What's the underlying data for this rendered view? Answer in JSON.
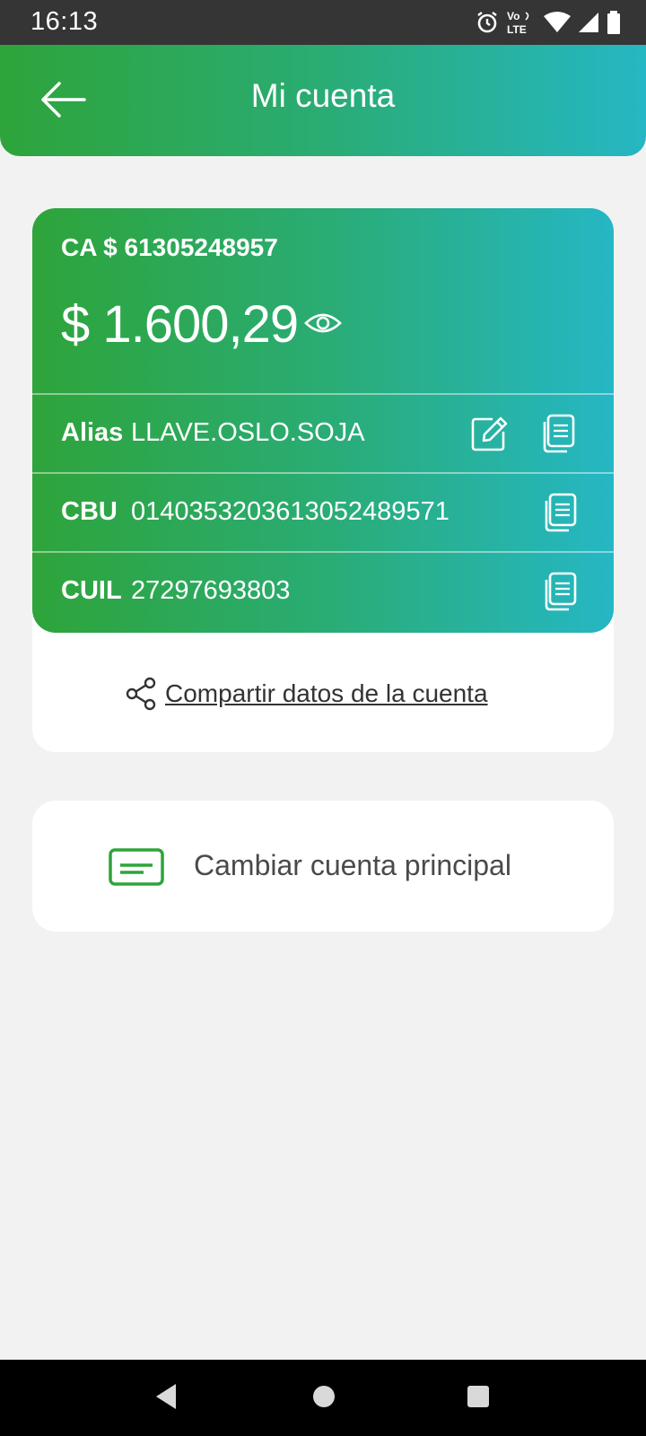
{
  "status_bar": {
    "time": "16:13",
    "icons": [
      "alarm-icon",
      "volte-icon",
      "wifi-icon",
      "signal-icon",
      "battery-icon"
    ],
    "volte_label": "Vo",
    "lte_label": "LTE"
  },
  "header": {
    "title": "Mi cuenta",
    "back_icon": "arrow-left-icon"
  },
  "account": {
    "number": "CA $ 61305248957",
    "balance": "$ 1.600,29",
    "rows": [
      {
        "label": "Alias",
        "value": "LLAVE.OSLO.SOJA"
      },
      {
        "label": "CBU",
        "value": "0140353203613052489571"
      },
      {
        "label": "CUIL",
        "value": "27297693803"
      }
    ]
  },
  "share": {
    "label": "Compartir datos de la cuenta",
    "icon": "share-icon"
  },
  "change_account": {
    "label": "Cambiar cuenta principal",
    "icon": "card-icon"
  },
  "colors": {
    "gradient_start": "#2ea43a",
    "gradient_end": "#25b7c4",
    "accent_green": "#2ea43a",
    "background": "#f2f2f2"
  },
  "nav_bar": [
    "back-triangle-icon",
    "home-circle-icon",
    "recents-square-icon"
  ]
}
